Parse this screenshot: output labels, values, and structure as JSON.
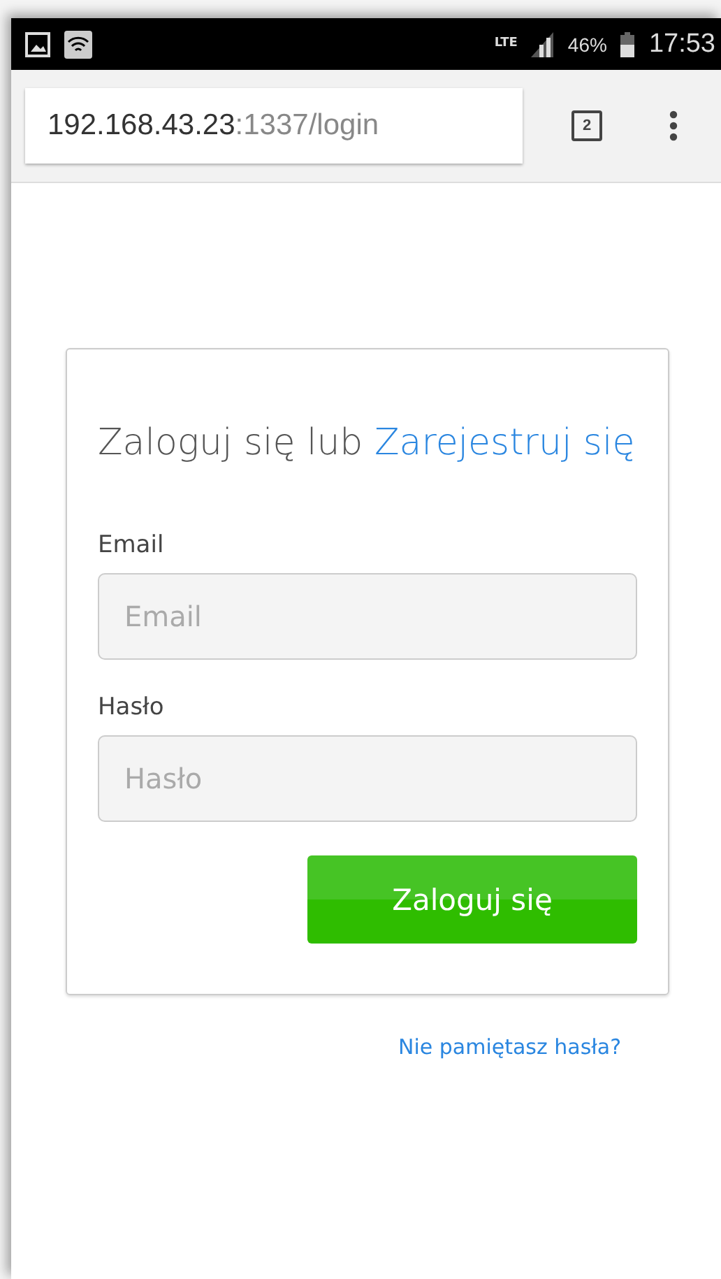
{
  "status_bar": {
    "network": "LTE",
    "battery": "46%",
    "time": "17:53"
  },
  "browser": {
    "url_host": "192.168.43.23",
    "url_rest": ":1337/login",
    "tab_count": "2"
  },
  "card": {
    "heading": "Zaloguj się lub",
    "register_link": "Zarejestruj się",
    "fields": [
      {
        "label": "Email",
        "placeholder": "Email"
      },
      {
        "label": "Hasło",
        "placeholder": "Hasło"
      }
    ],
    "submit": "Zaloguj się"
  },
  "forgot_link": "Nie pamiętasz hasła?"
}
